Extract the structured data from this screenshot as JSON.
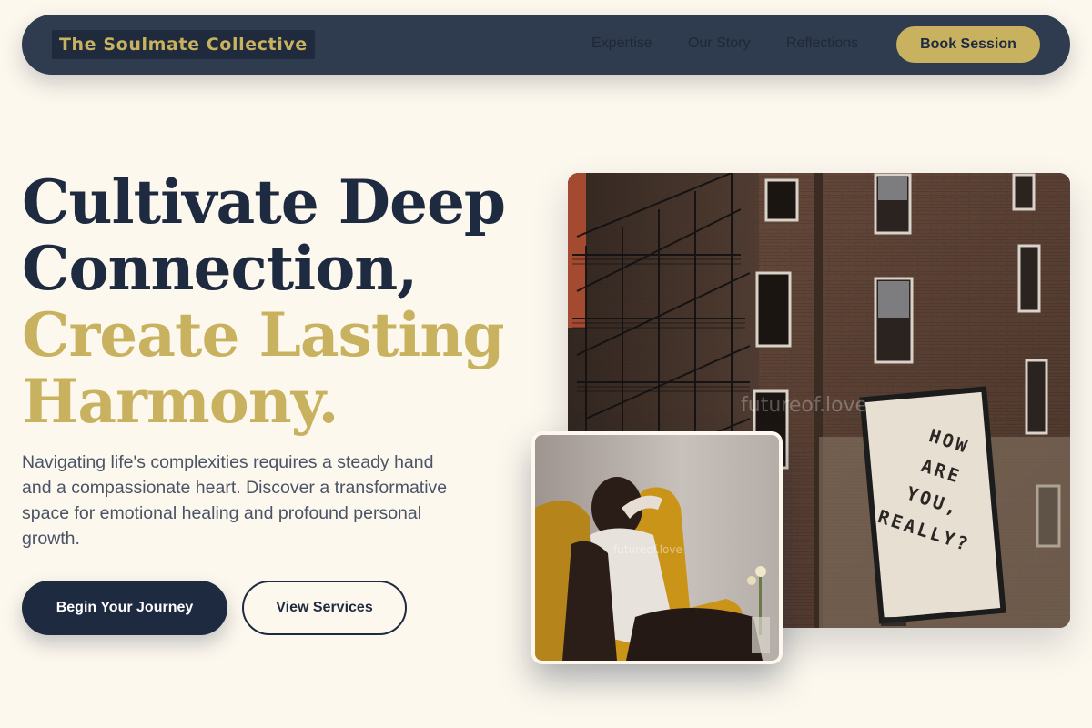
{
  "nav": {
    "brand": "The Soulmate Collective",
    "links": [
      "Expertise",
      "Our Story",
      "Reflections"
    ],
    "cta": "Book Session"
  },
  "hero": {
    "headline_lines": [
      "Cultivate Deep",
      "Connection,",
      "Create Lasting",
      "Harmony."
    ],
    "lead": "Navigating life's complexities requires a steady hand and a compassionate heart. Discover a transformative space for emotional healing and profound personal growth.",
    "primary_cta": "Begin Your Journey",
    "secondary_cta": "View Services"
  },
  "images": {
    "main_mural_text": [
      "HOW",
      "ARE",
      "YOU,",
      "REALLY?"
    ],
    "main_watermark": "futureof.love",
    "secondary_watermark": "futureof.love"
  },
  "colors": {
    "background": "#fdf8ee",
    "navy": "#1e2a40",
    "nav_bar": "#2f3b4e",
    "gold": "#c9b25f",
    "body_text": "#4a5466"
  }
}
